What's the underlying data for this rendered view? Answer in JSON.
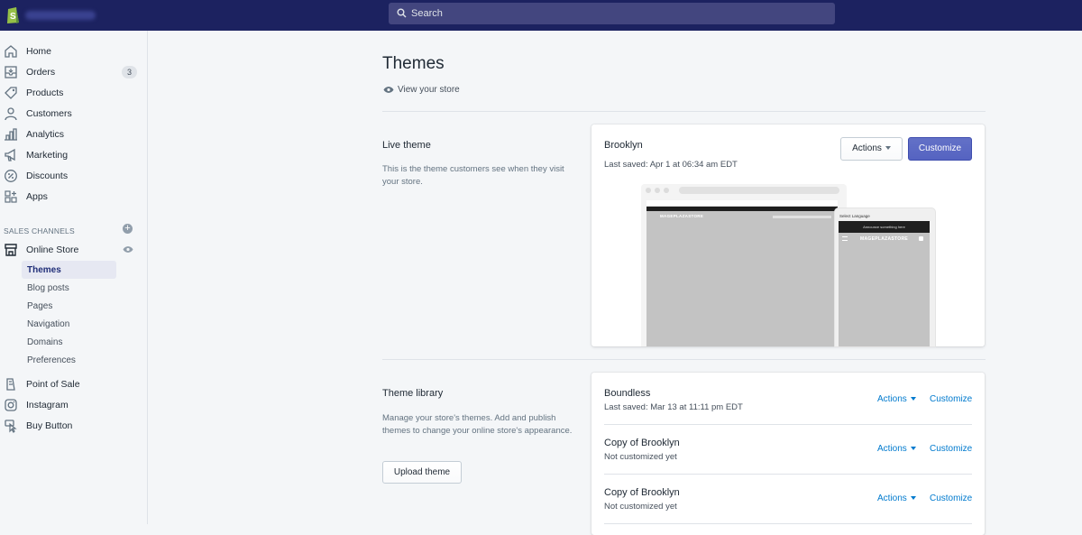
{
  "topbar": {
    "search_placeholder": "Search"
  },
  "sidebar": {
    "items": [
      {
        "label": "Home",
        "icon": "home-icon"
      },
      {
        "label": "Orders",
        "icon": "orders-icon",
        "badge": "3"
      },
      {
        "label": "Products",
        "icon": "tag-icon"
      },
      {
        "label": "Customers",
        "icon": "person-icon"
      },
      {
        "label": "Analytics",
        "icon": "bar-chart-icon"
      },
      {
        "label": "Marketing",
        "icon": "megaphone-icon"
      },
      {
        "label": "Discounts",
        "icon": "discount-icon"
      },
      {
        "label": "Apps",
        "icon": "apps-icon"
      }
    ],
    "sales_channels_label": "SALES CHANNELS",
    "online_store": "Online Store",
    "online_store_sub": [
      "Themes",
      "Blog posts",
      "Pages",
      "Navigation",
      "Domains",
      "Preferences"
    ],
    "other_channels": [
      {
        "label": "Point of Sale",
        "icon": "pos-icon"
      },
      {
        "label": "Instagram",
        "icon": "instagram-icon"
      },
      {
        "label": "Buy Button",
        "icon": "buy-button-icon"
      }
    ]
  },
  "main": {
    "title": "Themes",
    "view_store": "View your store",
    "live_theme": {
      "heading": "Live theme",
      "description": "This is the theme customers see when they visit your store.",
      "theme_name": "Brooklyn",
      "last_saved": "Last saved: Apr 1 at 06:34 am EDT",
      "actions_label": "Actions",
      "customize_label": "Customize",
      "preview": {
        "desktop_logo": "MAGEPLAZASTORE",
        "mobile_logo": "MAGEPLAZASTORE",
        "mobile_lang": "Select Language",
        "mobile_banner": "Announce something here"
      }
    },
    "library": {
      "heading": "Theme library",
      "description": "Manage your store's themes. Add and publish themes to change your online store's appearance.",
      "upload_label": "Upload theme",
      "themes": [
        {
          "name": "Boundless",
          "status": "Last saved: Mar 13 at 11:11 pm EDT",
          "actions": "Actions",
          "customize": "Customize"
        },
        {
          "name": "Copy of Brooklyn",
          "status": "Not customized yet",
          "actions": "Actions",
          "customize": "Customize"
        },
        {
          "name": "Copy of Brooklyn",
          "status": "Not customized yet",
          "actions": "Actions",
          "customize": "Customize"
        }
      ]
    }
  },
  "colors": {
    "topbar": "#1c2260",
    "primary": "#5c6ac4",
    "link": "#007ace",
    "active_nav": "#202e78"
  }
}
